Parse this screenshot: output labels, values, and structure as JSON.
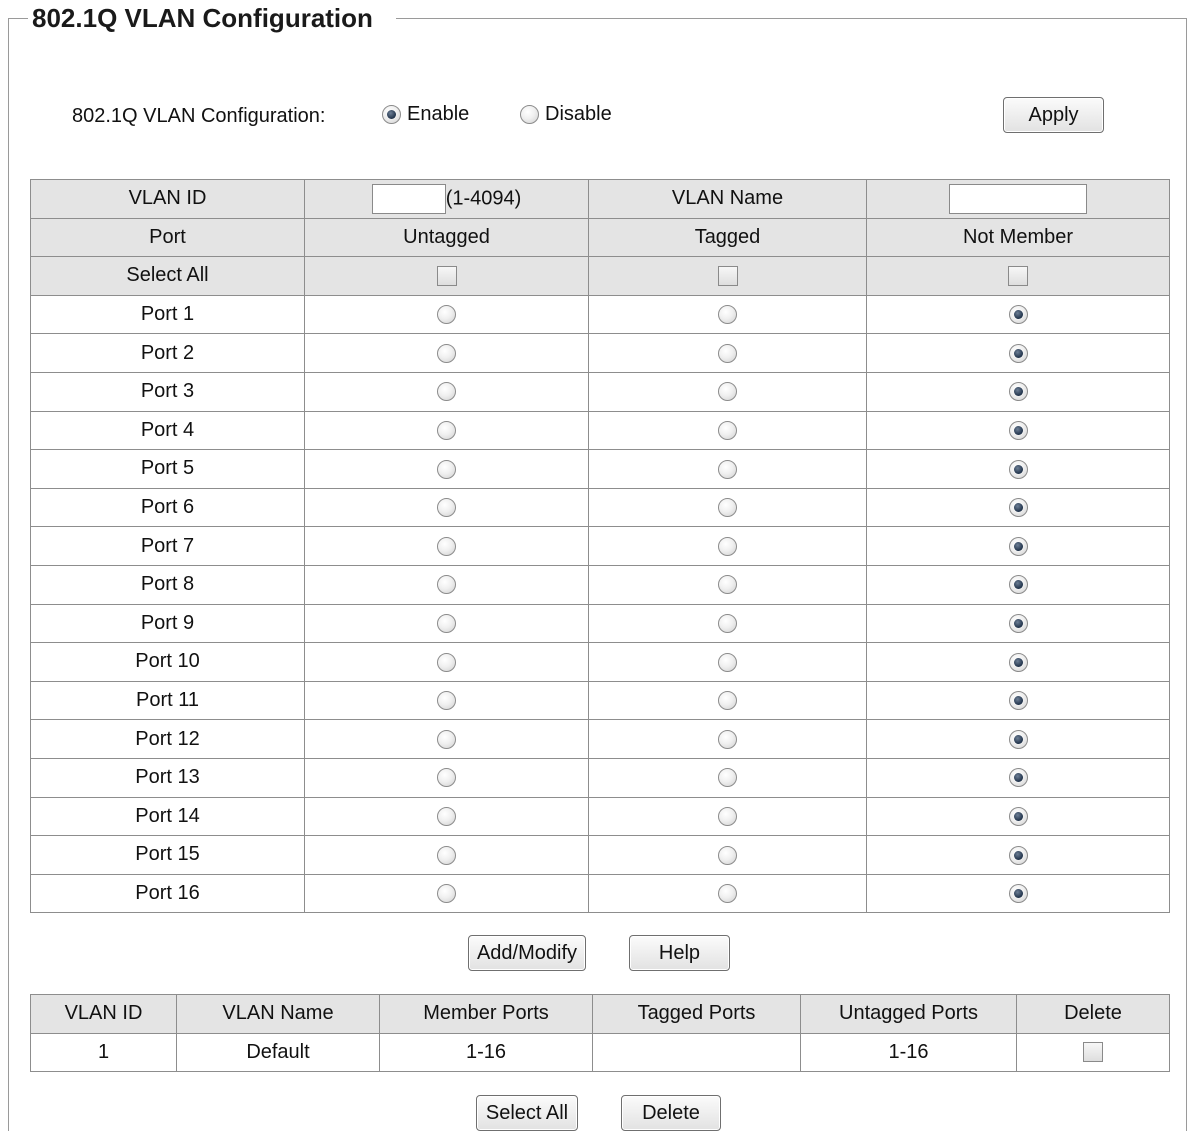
{
  "title": "802.1Q VLAN Configuration",
  "config": {
    "label": "802.1Q VLAN Configuration:",
    "enable_label": "Enable",
    "disable_label": "Disable",
    "selected": "Enable",
    "apply_label": "Apply"
  },
  "form": {
    "vlan_id_label": "VLAN ID",
    "vlan_id_value": "",
    "vlan_id_range": "(1-4094)",
    "vlan_name_label": "VLAN Name",
    "vlan_name_value": "",
    "headers": {
      "port": "Port",
      "untagged": "Untagged",
      "tagged": "Tagged",
      "not_member": "Not Member"
    },
    "select_all_label": "Select All",
    "ports": [
      {
        "name": "Port 1",
        "membership": "not_member"
      },
      {
        "name": "Port 2",
        "membership": "not_member"
      },
      {
        "name": "Port 3",
        "membership": "not_member"
      },
      {
        "name": "Port 4",
        "membership": "not_member"
      },
      {
        "name": "Port 5",
        "membership": "not_member"
      },
      {
        "name": "Port 6",
        "membership": "not_member"
      },
      {
        "name": "Port 7",
        "membership": "not_member"
      },
      {
        "name": "Port 8",
        "membership": "not_member"
      },
      {
        "name": "Port 9",
        "membership": "not_member"
      },
      {
        "name": "Port 10",
        "membership": "not_member"
      },
      {
        "name": "Port 11",
        "membership": "not_member"
      },
      {
        "name": "Port 12",
        "membership": "not_member"
      },
      {
        "name": "Port 13",
        "membership": "not_member"
      },
      {
        "name": "Port 14",
        "membership": "not_member"
      },
      {
        "name": "Port 15",
        "membership": "not_member"
      },
      {
        "name": "Port 16",
        "membership": "not_member"
      }
    ],
    "add_modify_label": "Add/Modify",
    "help_label": "Help"
  },
  "vlan_list": {
    "headers": [
      "VLAN ID",
      "VLAN Name",
      "Member Ports",
      "Tagged Ports",
      "Untagged Ports",
      "Delete"
    ],
    "rows": [
      {
        "id": "1",
        "name": "Default",
        "member_ports": "1-16",
        "tagged_ports": "",
        "untagged_ports": "1-16",
        "delete": false
      }
    ],
    "select_all_label": "Select All",
    "delete_label": "Delete"
  }
}
